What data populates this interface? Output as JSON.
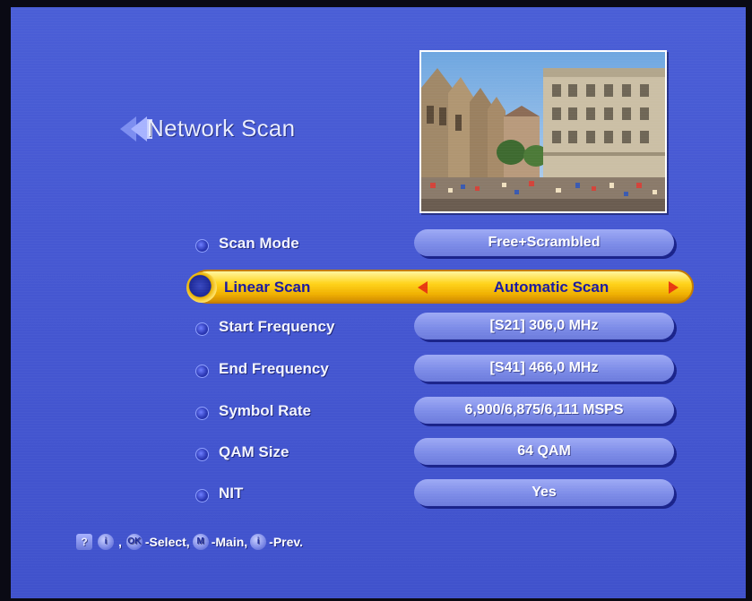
{
  "screen": {
    "title": "Network Scan",
    "title_icon": "double-left-arrow-icon",
    "preview_image": "live-tv-preview (town square with buildings and crowd)"
  },
  "menu": [
    {
      "label": "Scan Mode",
      "value": "Free+Scrambled"
    },
    {
      "label": "Linear Scan",
      "value": "Automatic Scan",
      "selected": true
    },
    {
      "label": "Start Frequency",
      "value": "[S21]  306,0 MHz"
    },
    {
      "label": "End Frequency",
      "value": "[S41]  466,0 MHz"
    },
    {
      "label": "Symbol Rate",
      "value": "6,900/6,875/6,111 MSPS"
    },
    {
      "label": "QAM Size",
      "value": "64 QAM"
    },
    {
      "label": "NIT",
      "value": "Yes"
    }
  ],
  "footer": {
    "help_icon": "?",
    "info_icon": "i",
    "ok_icon": "OK",
    "select_text": "-Select,",
    "main_icon": "M",
    "main_text": "-Main,",
    "prev_icon": "i",
    "prev_text": "-Prev."
  },
  "colors": {
    "background": "#4658d2",
    "highlight": "#ffd31a",
    "pill": "#8593ea",
    "arrow": "#e83a10"
  }
}
